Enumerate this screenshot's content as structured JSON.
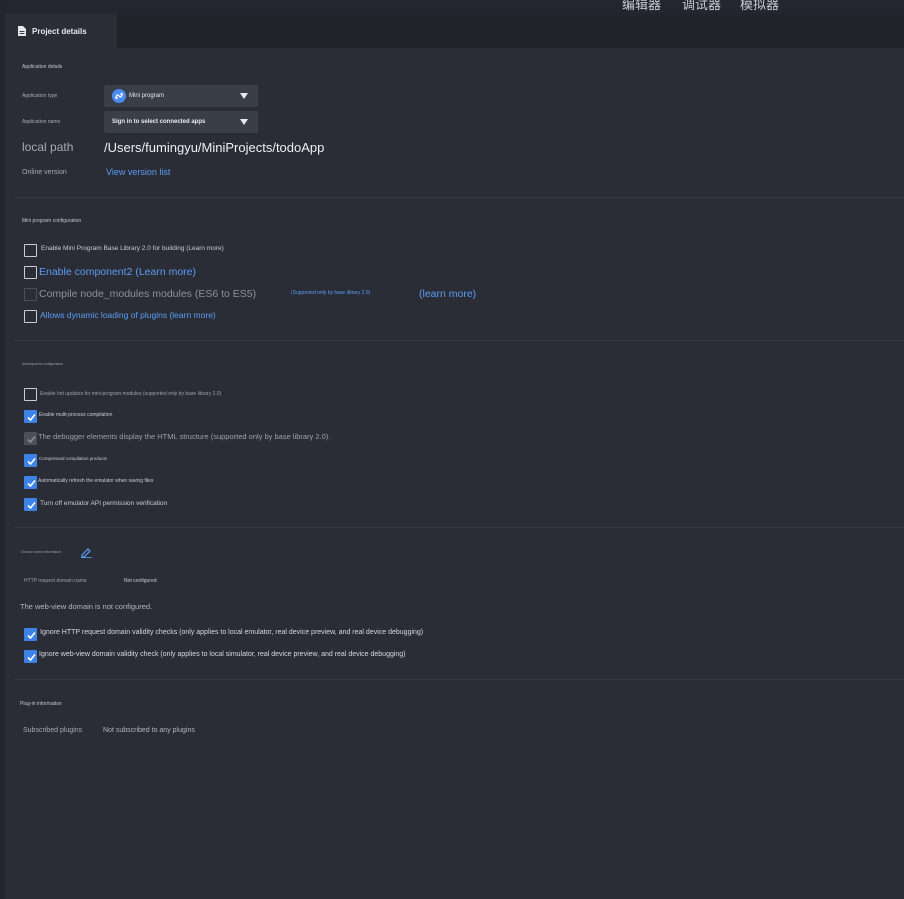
{
  "top_menu": [
    "编辑器",
    "调试器",
    "模拟器"
  ],
  "tab": {
    "label": "Project details",
    "icon": "document-icon"
  },
  "application_details": {
    "title": "Application details",
    "type_label": "Application type",
    "type_value": "Mini program",
    "name_label": "Application name",
    "name_value": "Sign in to select connected apps",
    "local_path_label": "local path",
    "local_path_value": "/Users/fumingyu/MiniProjects/todoApp",
    "online_version_label": "Online version",
    "online_version_link": "View version list"
  },
  "mini_program_config": {
    "title": "Mini program configuration",
    "options": [
      {
        "label": "Enable Mini Program Base Library 2.0 for building (Learn more)",
        "checked": false
      },
      {
        "label": "Enable component2 (Learn more)",
        "checked": false
      },
      {
        "label": "Compile node_modules modules (ES6 to ES5)",
        "note": "(Supported only by base library 2.0)",
        "link": "(learn more)",
        "checked": false,
        "disabled": true
      },
      {
        "label": "Allows dynamic loading of plugins (learn more)",
        "checked": false
      }
    ]
  },
  "development_config": {
    "title": "development configuration",
    "options": [
      {
        "label": "Enable hot updates for mini-program modules (supported only by base library 2.0)",
        "checked": false
      },
      {
        "label": "Enable multi-process compilation",
        "checked": true
      },
      {
        "label": "The debugger elements display the HTML structure (supported only by base library 2.0).",
        "checked": true,
        "disabled": true
      },
      {
        "label": "Compressed compilation products",
        "checked": true
      },
      {
        "label": "Automatically refresh the emulator when saving files",
        "checked": true
      },
      {
        "label": "Turn off emulator API permission verification",
        "checked": true
      }
    ]
  },
  "domain_info": {
    "title": "Domain name information",
    "http_label": "HTTP request domain name",
    "http_value": "Not configured",
    "webview_text": "The web-view domain is not configured.",
    "options": [
      {
        "label": "Ignore HTTP request domain validity checks (only applies to local emulator, real device preview, and real device debugging)",
        "checked": true
      },
      {
        "label": "Ignore web-view domain validity check (only applies to local simulator, real device preview, and real device debugging)",
        "checked": true
      }
    ]
  },
  "plugin_info": {
    "title": "Plug-in information",
    "subscribed_label": "Subscribed plugins",
    "subscribed_value": "Not subscribed to any plugins"
  },
  "colors": {
    "accent": "#3d82e6",
    "link": "#5b9df3",
    "background": "#2a2d36"
  }
}
